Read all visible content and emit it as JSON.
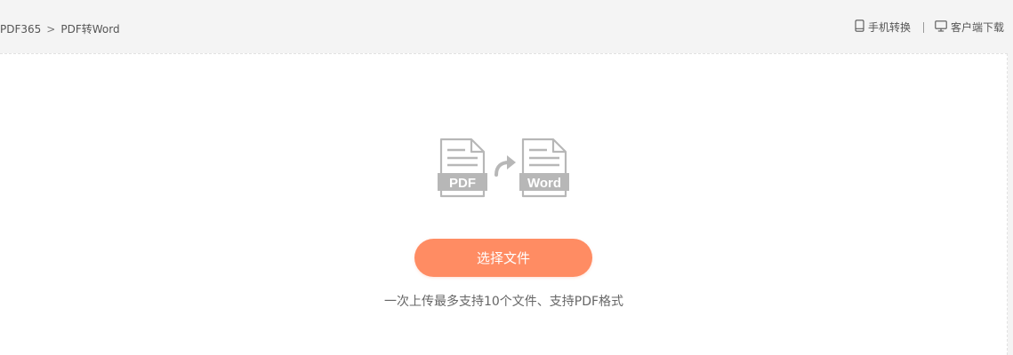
{
  "breadcrumb": {
    "home": "PDF365",
    "separator": ">",
    "current": "PDF转Word"
  },
  "actions": {
    "mobile_label": "手机转换",
    "mobile_icon": "phone-icon",
    "desktop_label": "客户端下载",
    "desktop_icon": "monitor-icon"
  },
  "illustration": {
    "from_label": "PDF",
    "to_label": "Word",
    "icons": [
      "pdf-file-icon",
      "curved-arrow-icon",
      "word-file-icon"
    ]
  },
  "upload": {
    "button_label": "选择文件",
    "hint": "一次上传最多支持10个文件、支持PDF格式"
  },
  "colors": {
    "accent": "#ff8c63",
    "icon_gray": "#b7b7b7",
    "page_bg": "#f4f4f4",
    "panel_bg": "#ffffff"
  }
}
